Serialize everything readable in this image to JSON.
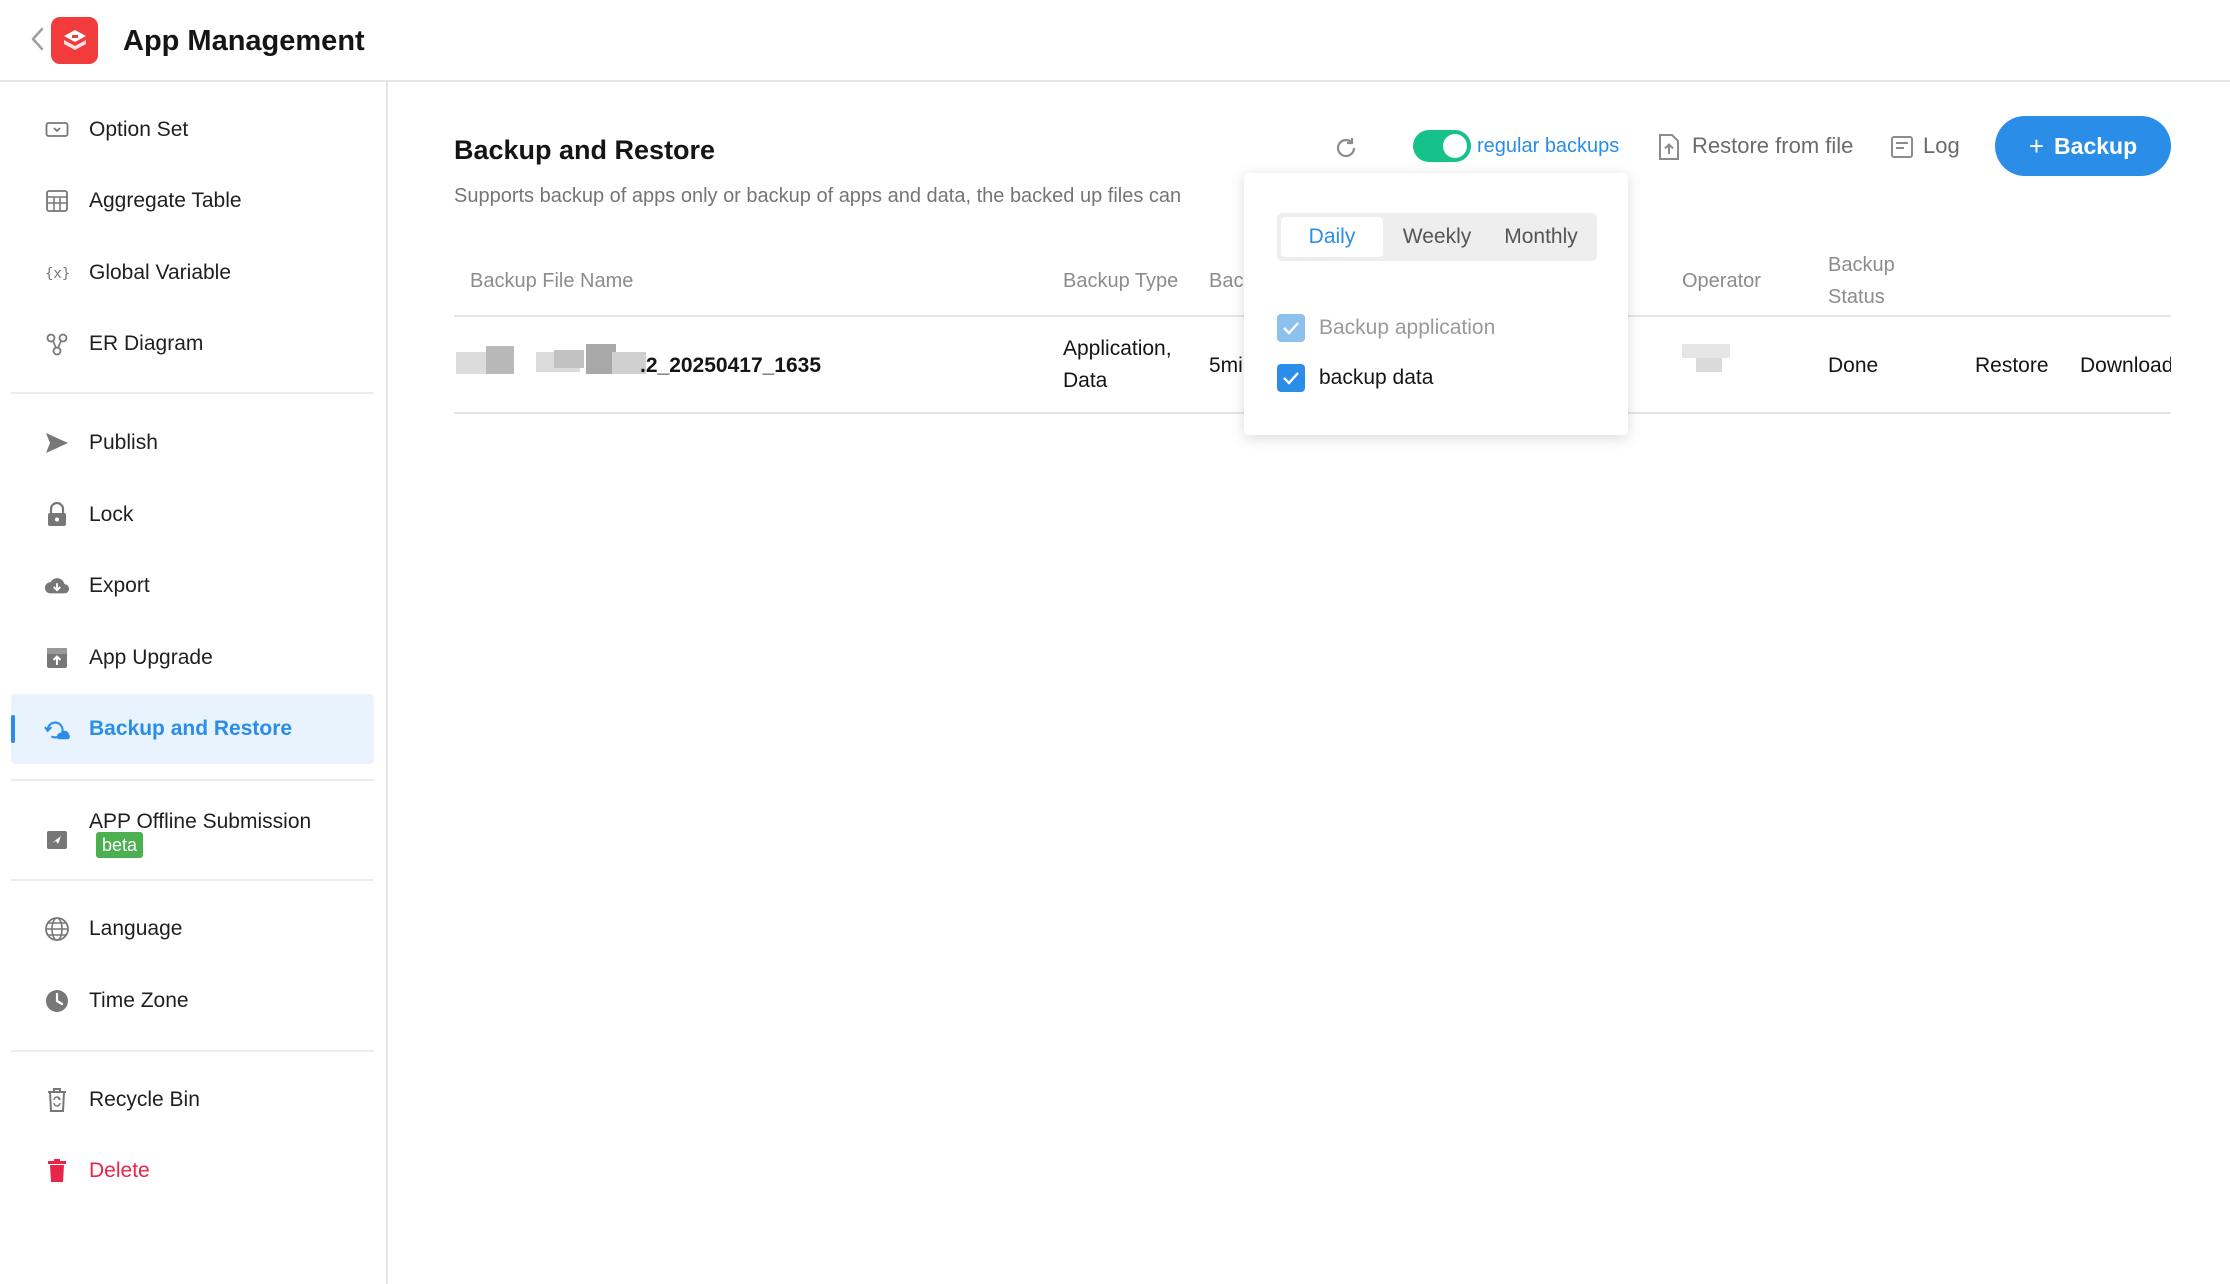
{
  "header": {
    "title": "App Management"
  },
  "sidebar": {
    "items": [
      {
        "label": "Option Set",
        "icon": "option-set-icon"
      },
      {
        "label": "Aggregate Table",
        "icon": "aggregate-table-icon"
      },
      {
        "label": "Global Variable",
        "icon": "global-variable-icon"
      },
      {
        "label": "ER Diagram",
        "icon": "er-diagram-icon"
      },
      {
        "label": "Publish",
        "icon": "send-icon"
      },
      {
        "label": "Lock",
        "icon": "lock-icon"
      },
      {
        "label": "Export",
        "icon": "cloud-download-icon"
      },
      {
        "label": "App Upgrade",
        "icon": "upgrade-box-icon"
      },
      {
        "label": "Backup and Restore",
        "icon": "backup-restore-icon"
      },
      {
        "label": "APP Offline Submission",
        "icon": "offline-submission-icon"
      },
      {
        "label": "Language",
        "icon": "globe-icon"
      },
      {
        "label": "Time Zone",
        "icon": "clock-icon"
      },
      {
        "label": "Recycle Bin",
        "icon": "recycle-bin-icon"
      },
      {
        "label": "Delete",
        "icon": "trash-icon"
      }
    ],
    "beta_badge": "beta",
    "active": "Backup and Restore"
  },
  "main": {
    "title": "Backup and Restore",
    "description": "Supports backup of apps only or backup of apps and data, the backed up files can",
    "toolbar": {
      "regular_backups_label": "regular backups",
      "regular_backups_enabled": true,
      "restore_from_file": "Restore from file",
      "log": "Log",
      "backup_button": "Backup",
      "backup_plus": "+"
    },
    "table": {
      "columns": [
        "Backup File Name",
        "Backup Type",
        "Bac",
        "Operator",
        "Backup",
        "Status"
      ],
      "rows": [
        {
          "file_name_suffix": ".2_20250417_1635",
          "type_line1": "Application,",
          "type_line2": "Data",
          "partial": "5mi",
          "status": "Done",
          "restore": "Restore",
          "download": "Download"
        }
      ]
    }
  },
  "popover": {
    "frequency_options": [
      "Daily",
      "Weekly",
      "Monthly"
    ],
    "selected_frequency": "Daily",
    "backup_application_label": "Backup application",
    "backup_application_checked": true,
    "backup_application_disabled": true,
    "backup_data_label": "backup data",
    "backup_data_checked": true
  },
  "colors": {
    "accent": "#2a8ee8",
    "toggle_on": "#16c28a",
    "danger": "#e8244a",
    "logo": "#f23b3b",
    "beta": "#4caf50"
  }
}
